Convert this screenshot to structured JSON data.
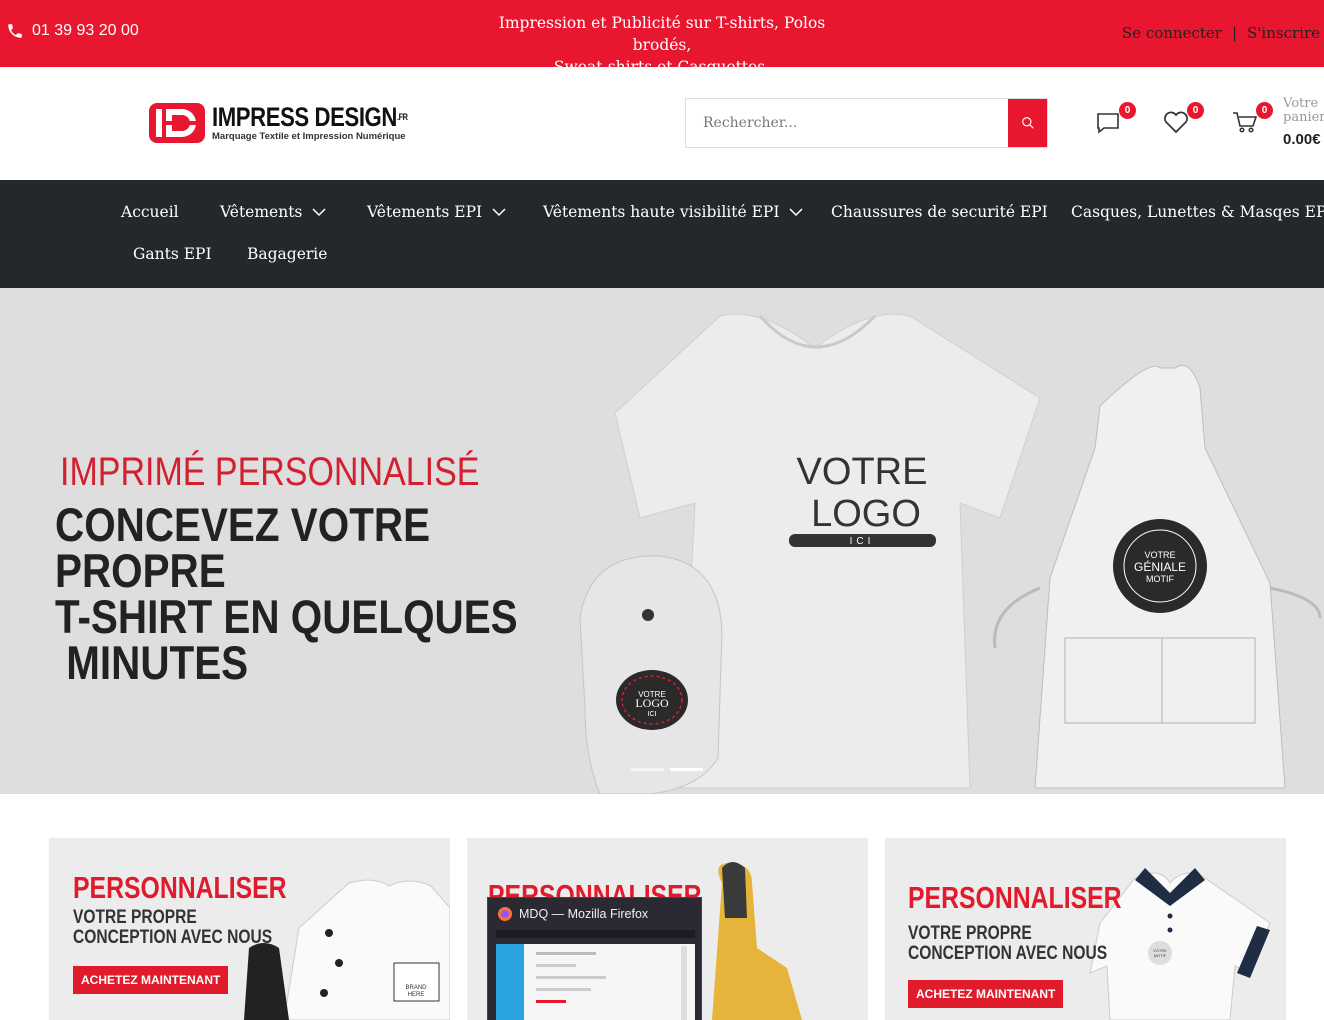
{
  "topbar": {
    "phone": "01 39 93 20 00",
    "promo_line1": "Impression et Publicité sur T-shirts, Polos brodés,",
    "promo_line2": "Sweat-shirts et Casquettes.",
    "login": "Se connecter",
    "separator": "|",
    "register": "S'inscrire"
  },
  "header": {
    "logo_main": "IMPRESS DESIGN",
    "logo_suffix": ".FR",
    "logo_sub": "Marquage Textile et Impression Numérique",
    "search_placeholder": "Rechercher...",
    "compare_count": "0",
    "wishlist_count": "0",
    "cart_count": "0",
    "cart_label_line1": "Votre",
    "cart_label_line2": "panier",
    "cart_total": "0.00€"
  },
  "nav": {
    "items": [
      {
        "label": "Accueil"
      },
      {
        "label": "Vêtements"
      },
      {
        "label": "Vêtements EPI"
      },
      {
        "label": "Vêtements haute visibilité EPI"
      },
      {
        "label": "Chaussures de securité EPI"
      },
      {
        "label": "Casques, Lunettes & Masqes EPI"
      },
      {
        "label": "Gants EPI"
      },
      {
        "label": "Bagagerie"
      }
    ]
  },
  "hero": {
    "kicker": "IMPRIMÉ PERSONNALISÉ",
    "title_line1": "CONCEVEZ VOTRE PROPRE",
    "title_line2": "T-SHIRT EN QUELQUES",
    "title_line3": " MINUTES",
    "tshirt_text_line1": "VOTRE",
    "tshirt_text_line2": "LOGO",
    "tshirt_text_line3": "ICI",
    "apron_badge_line1": "VOTRE",
    "apron_badge_line2": "GÉNIALE",
    "apron_badge_line3": "MOTIF",
    "cap_badge_line1": "VOTRE",
    "cap_badge_line2": "LOGO",
    "cap_badge_line3": "ICI",
    "slides_total": 2,
    "active_slide": 2
  },
  "cards": [
    {
      "title": "PERSONNALISER",
      "sub_line1": "VOTRE PROPRE",
      "sub_line2": "CONCEPTION AVEC NOUS",
      "button": "ACHETEZ MAINTENANT",
      "product_label_line1": "BRAND",
      "product_label_line2": "HERE"
    },
    {
      "title": "PERSONNALISER",
      "sub_line1": "",
      "sub_line2": "",
      "button": ""
    },
    {
      "title": "PERSONNALISER",
      "sub_line1": "VOTRE PROPRE",
      "sub_line2": "CONCEPTION AVEC NOUS",
      "button": "ACHETEZ MAINTENANT",
      "product_label_line1": "VOTRE",
      "product_label_line2": "MOTIF"
    }
  ],
  "popup": {
    "title": "MDQ — Mozilla Firefox"
  },
  "colors": {
    "brand_red": "#e8172f",
    "nav_bg": "#24272b",
    "hero_bg": "#dedede"
  }
}
